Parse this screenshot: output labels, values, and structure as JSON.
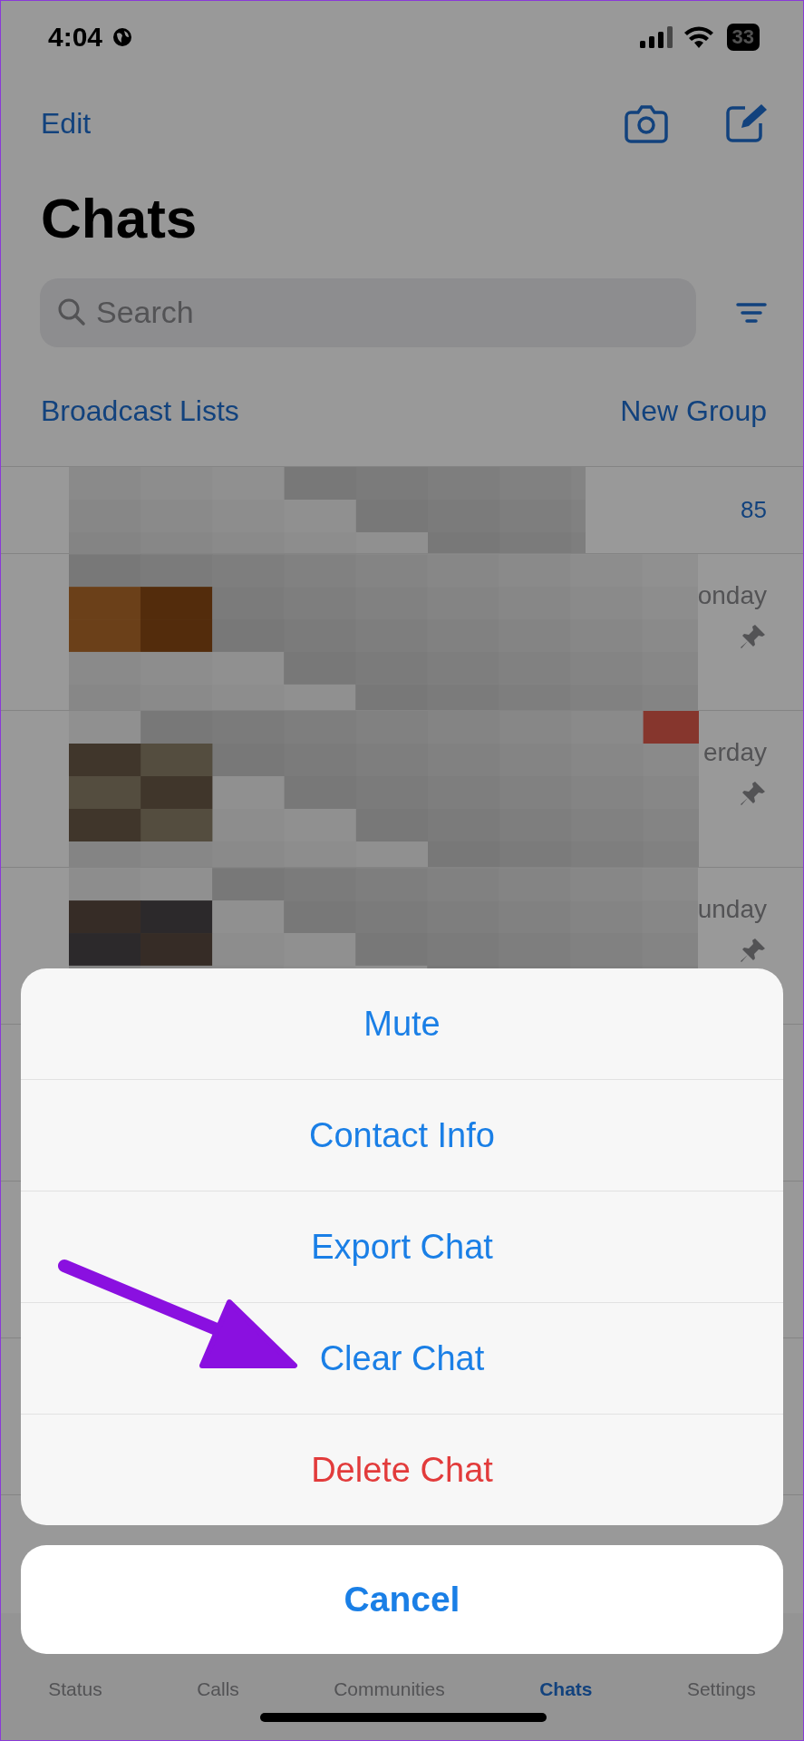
{
  "status_bar": {
    "time": "4:04",
    "battery": "33"
  },
  "nav": {
    "edit": "Edit"
  },
  "title": "Chats",
  "search": {
    "placeholder": "Search"
  },
  "links": {
    "left": "Broadcast Lists",
    "right": "New Group"
  },
  "archived": {
    "count": "85"
  },
  "chats": [
    {
      "time": "onday",
      "pinned": true
    },
    {
      "time": "erday",
      "pinned": true
    },
    {
      "time": "unday",
      "pinned": true
    }
  ],
  "action_sheet": {
    "items": [
      {
        "label": "Mute",
        "kind": "default"
      },
      {
        "label": "Contact Info",
        "kind": "default"
      },
      {
        "label": "Export Chat",
        "kind": "default"
      },
      {
        "label": "Clear Chat",
        "kind": "default"
      },
      {
        "label": "Delete Chat",
        "kind": "destructive"
      }
    ],
    "cancel": "Cancel"
  },
  "tab_bar": [
    {
      "label": "Status",
      "selected": false
    },
    {
      "label": "Calls",
      "selected": false
    },
    {
      "label": "Communities",
      "selected": false
    },
    {
      "label": "Chats",
      "selected": true
    },
    {
      "label": "Settings",
      "selected": false
    }
  ]
}
